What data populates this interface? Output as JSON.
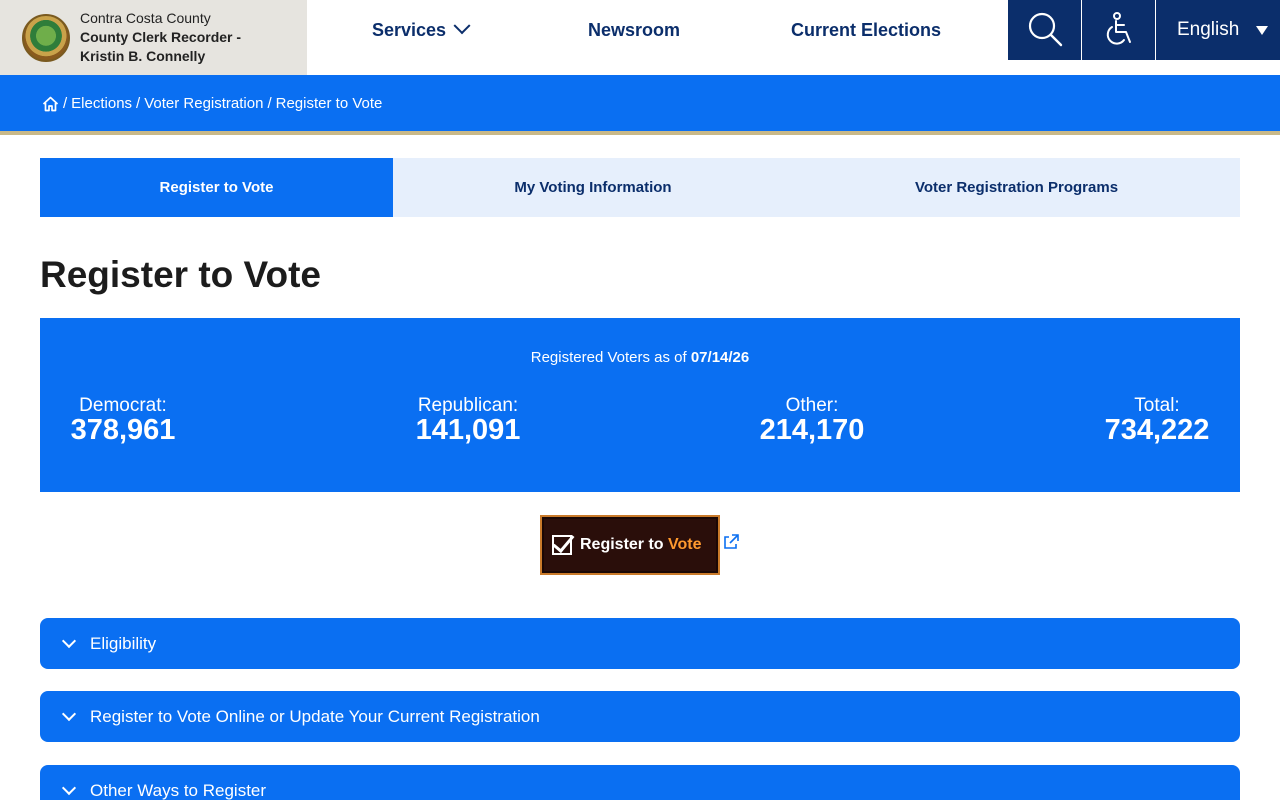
{
  "header": {
    "county": "Contra Costa County",
    "office": "County Clerk Recorder -",
    "name": "Kristin B. Connelly",
    "nav": [
      {
        "label": "Services"
      },
      {
        "label": "Newsroom"
      },
      {
        "label": "Current Elections"
      }
    ],
    "language": "English",
    "tool_icons": [
      "search-icon",
      "accessibility-icon"
    ]
  },
  "breadcrumb": {
    "home_icon": "home-icon",
    "items": [
      "Elections",
      "Voter Registration",
      "Register to Vote"
    ]
  },
  "tabs": [
    {
      "label": "Register to Vote",
      "active": true
    },
    {
      "label": "My Voting Information",
      "active": false
    },
    {
      "label": "Voter Registration Programs",
      "active": false
    }
  ],
  "page_title": "Register to Vote",
  "stats": {
    "as_of_label": "Registered Voters as of",
    "as_of_date": "07/14/26",
    "items": [
      {
        "label": "Democrat:",
        "value": "378,961"
      },
      {
        "label": "Republican:",
        "value": "141,091"
      },
      {
        "label": "Other:",
        "value": "214,170"
      },
      {
        "label": "Total:",
        "value": "734,222"
      }
    ]
  },
  "register_button": {
    "text_main": "Register to",
    "text_accent": "Vote"
  },
  "accordions": [
    {
      "label": "Eligibility"
    },
    {
      "label": "Register to Vote Online or Update Your Current Registration"
    },
    {
      "label": "Other Ways to Register"
    }
  ],
  "colors": {
    "primary": "#0a6ff2",
    "navy": "#0b2e6b",
    "tab_bg": "#e6effc",
    "brand_bg": "#e6e4df"
  }
}
